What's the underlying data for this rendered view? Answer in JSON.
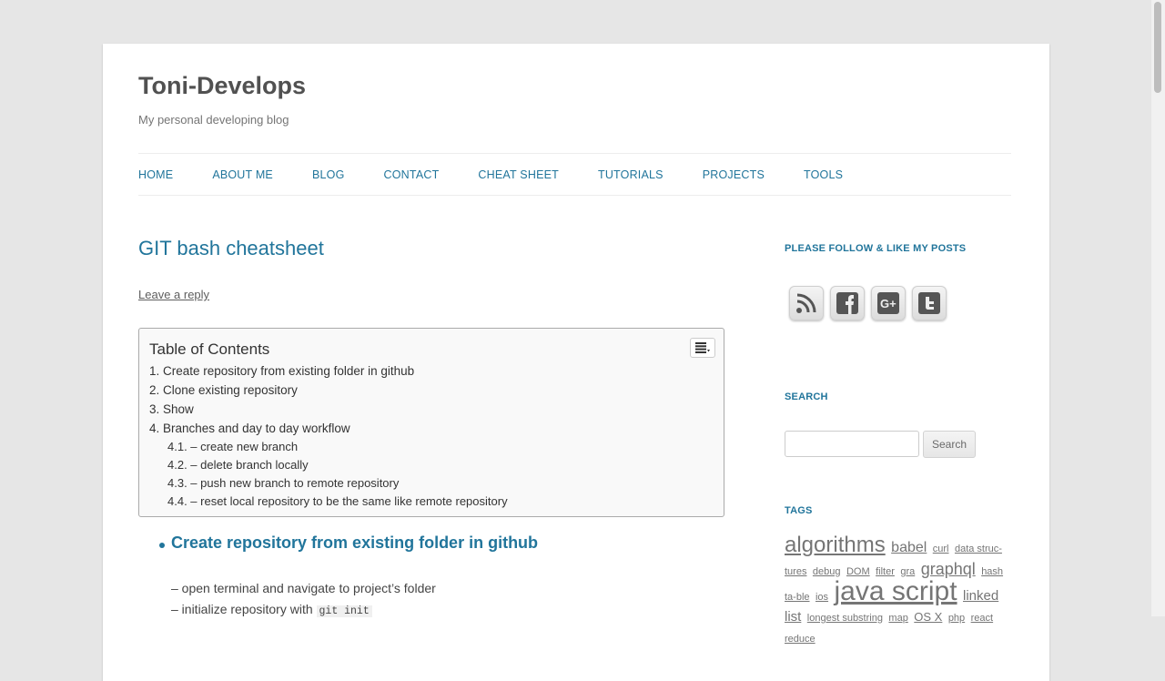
{
  "site": {
    "title": "Toni-Develops",
    "description": "My personal developing blog"
  },
  "nav": [
    "HOME",
    "ABOUT ME",
    "BLOG",
    "CONTACT",
    "CHEAT SHEET",
    "TUTORIALS",
    "PROJECTS",
    "TOOLS"
  ],
  "post": {
    "title": "GIT bash cheatsheet",
    "leave_reply": "Leave a reply",
    "toc": {
      "title": "Table of Contents",
      "items": [
        "1. Create repository from existing folder in github",
        "2. Clone existing repository",
        "3. Show",
        "4. Branches and day to day workflow"
      ],
      "subitems": [
        "4.1. – create new branch",
        "4.2. – delete branch locally",
        "4.3. – push new branch to remote repository",
        "4.4. – reset local repository to be the same like remote repository"
      ]
    },
    "section1": {
      "heading": "Create repository from existing folder in github",
      "line1": "– open terminal and navigate to project’s folder",
      "line2_text": "– initialize repository with ",
      "line2_code": "git init"
    }
  },
  "sidebar": {
    "follow_title": "PLEASE FOLLOW & LIKE MY POSTS",
    "social_icons": [
      "rss-icon",
      "facebook-icon",
      "google-plus-icon",
      "twitter-icon"
    ],
    "search_title": "SEARCH",
    "search_button": "Search",
    "tags_title": "TAGS",
    "tags": [
      {
        "label": "algorithms",
        "size": 24
      },
      {
        "label": "babel",
        "size": 16
      },
      {
        "label": "curl",
        "size": 11
      },
      {
        "label": "data struc-tures",
        "size": 11
      },
      {
        "label": "debug",
        "size": 11
      },
      {
        "label": "DOM",
        "size": 11
      },
      {
        "label": "filter",
        "size": 11
      },
      {
        "label": "gra",
        "size": 11
      },
      {
        "label": "graphql",
        "size": 18
      },
      {
        "label": "hash ta-ble",
        "size": 11
      },
      {
        "label": "ios",
        "size": 11
      },
      {
        "label": "java script",
        "size": 30
      },
      {
        "label": "linked list",
        "size": 15
      },
      {
        "label": "longest substring",
        "size": 11
      },
      {
        "label": "map",
        "size": 11
      },
      {
        "label": "OS X",
        "size": 13
      },
      {
        "label": "php",
        "size": 11
      },
      {
        "label": "react",
        "size": 11
      },
      {
        "label": "reduce",
        "size": 11
      }
    ]
  }
}
